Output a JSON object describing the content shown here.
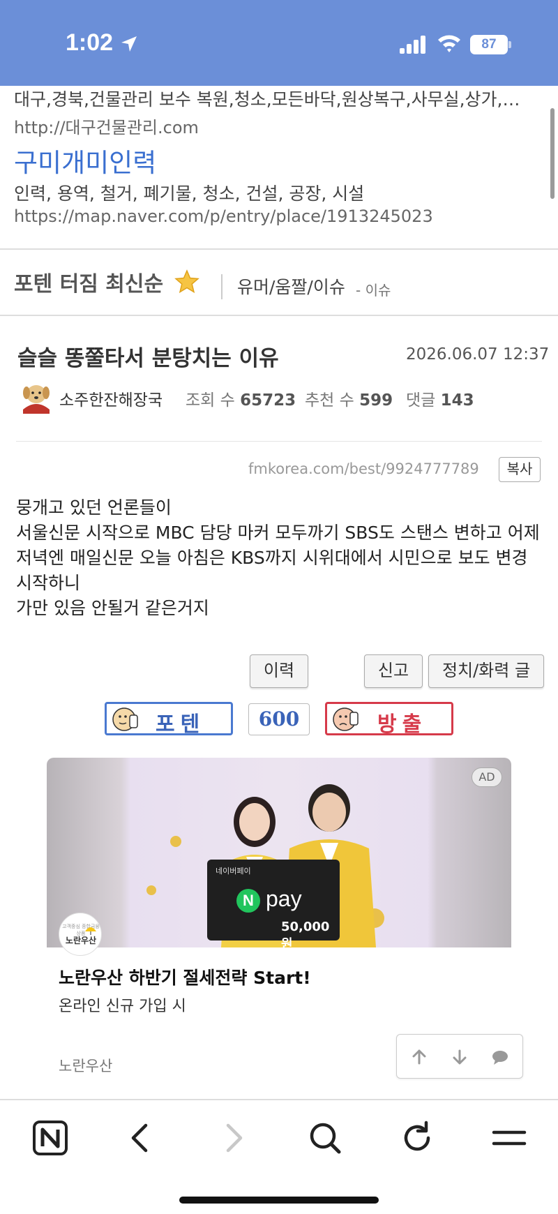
{
  "status_bar": {
    "time": "1:02",
    "battery": "87",
    "accent_color": "#6b8fd8"
  },
  "search_results": {
    "result1": {
      "description": "대구,경북,건물관리 보수 복원,청소,모든바닥,원상복구,사무실,상가,…",
      "url": "http://대구건물관리.com"
    },
    "result2": {
      "title": "구미개미인력",
      "description": "인력, 용역, 철거, 폐기물, 청소, 건설, 공장, 시설",
      "url": "https://map.naver.com/p/entry/place/1913245023"
    }
  },
  "board": {
    "title": "포텐 터짐 최신순",
    "category": "유머/움짤/이슈",
    "category_sub": "- 이슈"
  },
  "post": {
    "title": "슬슬 똥쭐타서 분탕치는 이유",
    "date": "2026.06.07 12:37",
    "author": "소주한잔해장국",
    "views_label": "조회 수",
    "views": "65723",
    "recommends_label": "추천 수",
    "recommends": "599",
    "comments_label": "댓글",
    "comments": "143",
    "url": "fmkorea.com/best/9924777789",
    "copy_label": "복사",
    "body": [
      "뭉개고 있던 언론들이",
      "서울신문 시작으로 MBC 담당 마커 모두까기 SBS도 스탠스 변하고 어제 저녁엔 매일신문 오늘 아침은 KBS까지 시위대에서 시민으로 보도 변경 시작하니",
      "가만 있음 안될거 같은거지"
    ],
    "buttons": {
      "history": "이력",
      "report": "신고",
      "politics": "정치/화력 글"
    },
    "vote": {
      "up_label": "포텐",
      "count": "600",
      "down_label": "방출",
      "up_color": "#4a79d0",
      "down_color": "#d63a4a"
    }
  },
  "ad": {
    "badge": "AD",
    "card_small": "네이버페이",
    "npay_logo": "N",
    "npay_word": "pay",
    "amount": "50,000원",
    "logo_tagline": "고객중심 종합금융 상품",
    "logo_text": "노란우산",
    "headline": "노란우산 하반기 절세전략 Start!",
    "subtitle": "온라인 신규 가입 시",
    "advertiser": "노란우산"
  },
  "float_bar": {
    "icons": [
      "arrow-up-icon",
      "arrow-down-icon",
      "comment-icon"
    ]
  },
  "toolbar": {
    "icons": [
      "naver-home-icon",
      "back-icon",
      "forward-icon",
      "search-icon",
      "reload-icon",
      "menu-icon"
    ]
  }
}
